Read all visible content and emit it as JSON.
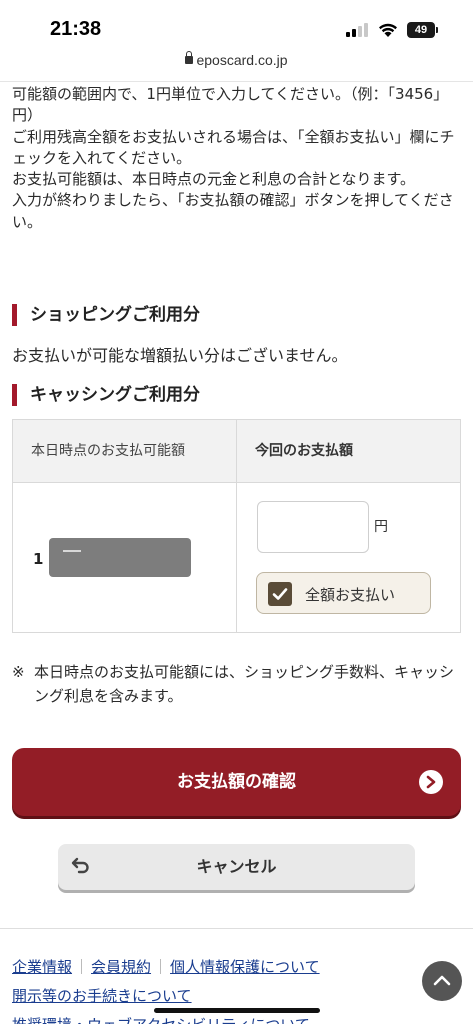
{
  "status_bar": {
    "time": "21:38",
    "battery": "49"
  },
  "url_bar": {
    "domain": "eposcard.co.jp"
  },
  "instructions": {
    "line1": "可能額の範囲内で、1円単位で入力してください。（例：「3456」円）",
    "line2": "ご利用残高全額をお支払いされる場合は、「全額お支払い」欄にチェックを入れてください。",
    "line3": "お支払可能額は、本日時点の元金と利息の合計となります。",
    "line4": "入力が終わりましたら、「お支払額の確認」ボタンを押してください。"
  },
  "shopping": {
    "heading": "ショッピングご利用分",
    "message": "お支払いが可能な増額払い分はございません。"
  },
  "cashing": {
    "heading": "キャッシングご利用分",
    "table": {
      "col_available": "本日時点のお支払可能額",
      "col_payment": "今回のお支払額",
      "amount_prefix": "1",
      "payment_value": "",
      "yen_unit": "円",
      "full_payment_label": "全額お支払い",
      "full_payment_checked": true
    }
  },
  "note": {
    "mark": "※",
    "text": "本日時点のお支払可能額には、ショッピング手数料、キャッシング利息を含みます。"
  },
  "buttons": {
    "confirm": "お支払額の確認",
    "cancel": "キャンセル"
  },
  "footer": {
    "links": [
      "企業情報",
      "会員規約",
      "個人情報保護について",
      "開示等のお手続きについて",
      "推奨環境・ウェブアクセシビリティについて"
    ]
  },
  "colors": {
    "accent": "#931d26",
    "heading_bar": "#a3192b",
    "link": "#1a3d8f",
    "checkbox": "#5a4c38"
  }
}
